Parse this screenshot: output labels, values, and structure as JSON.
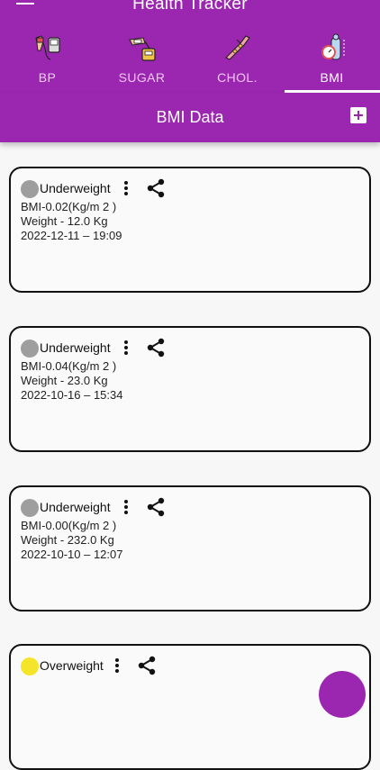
{
  "appbar": {
    "title": "Health Tracker",
    "background_color": "#9b27b0",
    "menu_icon": "hamburger-menu-icon"
  },
  "tabs": [
    {
      "label": "BP",
      "icon": "blood-pressure-icon",
      "active": false
    },
    {
      "label": "SUGAR",
      "icon": "glucose-meter-icon",
      "active": false
    },
    {
      "label": "CHOL.",
      "icon": "cholesterol-icon",
      "active": false
    },
    {
      "label": "BMI",
      "icon": "bmi-scale-icon",
      "active": true
    }
  ],
  "subbar": {
    "title": "BMI Data",
    "add_icon": "add-square-icon"
  },
  "records": [
    {
      "status": "Underweight",
      "status_color": "#9e9e9e",
      "bmi": "BMI-0.02(Kg/m 2 )",
      "weight": "Weight - 12.0 Kg",
      "datetime": "2022-12-11 – 19:09"
    },
    {
      "status": "Underweight",
      "status_color": "#9e9e9e",
      "bmi": "BMI-0.04(Kg/m 2 )",
      "weight": "Weight - 23.0 Kg",
      "datetime": "2022-10-16 – 15:34"
    },
    {
      "status": "Underweight",
      "status_color": "#9e9e9e",
      "bmi": "BMI-0.00(Kg/m 2 )",
      "weight": "Weight - 232.0 Kg",
      "datetime": "2022-10-10 – 12:07"
    },
    {
      "status": "Overweight",
      "status_color": "#f5e52a",
      "bmi": "",
      "weight": "",
      "datetime": ""
    }
  ],
  "fab": {
    "color": "#9b27b0"
  }
}
